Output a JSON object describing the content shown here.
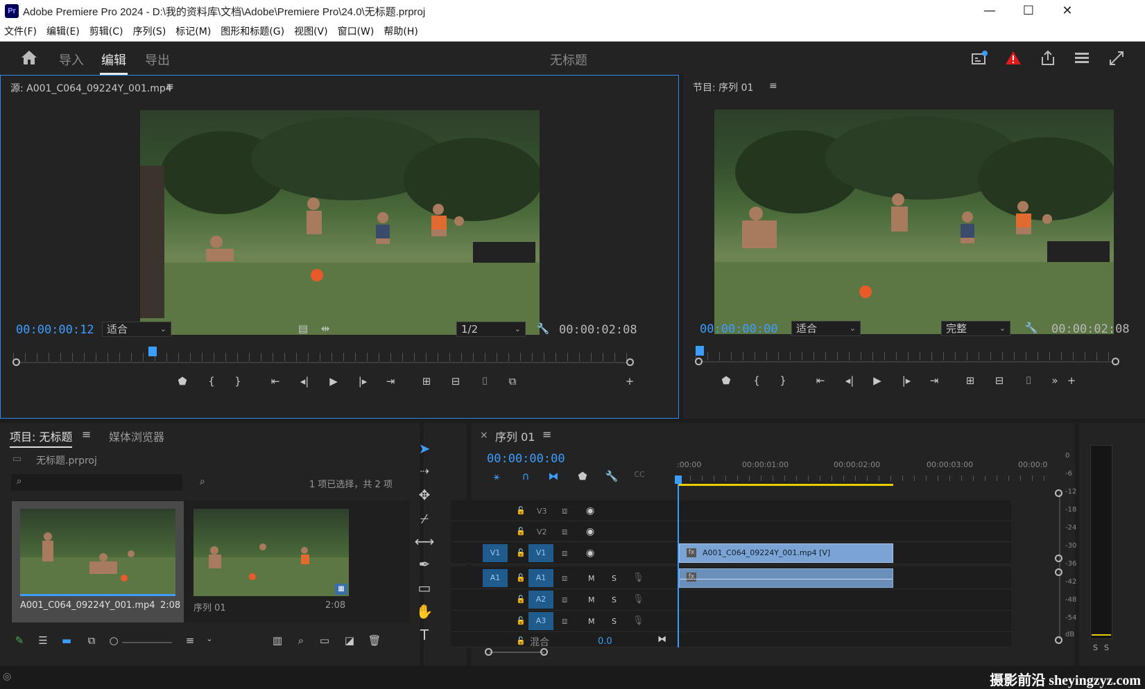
{
  "window": {
    "title": "Adobe Premiere Pro 2024 - D:\\我的资料库\\文档\\Adobe\\Premiere Pro\\24.0\\无标题.prproj",
    "app_badge": "Pr",
    "minimize": "—",
    "maximize": "☐",
    "close": "✕"
  },
  "menu": [
    "文件(F)",
    "编辑(E)",
    "剪辑(C)",
    "序列(S)",
    "标记(M)",
    "图形和标题(G)",
    "视图(V)",
    "窗口(W)",
    "帮助(H)"
  ],
  "workspace": {
    "tabs": [
      "导入",
      "编辑",
      "导出"
    ],
    "active": "编辑",
    "document": "无标题"
  },
  "source": {
    "title": "源: A001_C064_09224Y_001.mp4",
    "menu_icon": "≡",
    "timecode": "00:00:00:12",
    "fit": "适合",
    "resolution": "1/2",
    "duration": "00:00:02:08",
    "playhead_fraction": 0.22
  },
  "program": {
    "title": "节目: 序列 01",
    "menu_icon": "≡",
    "timecode": "00:00:00:00",
    "fit": "适合",
    "quality": "完整",
    "duration": "00:00:02:08",
    "playhead_fraction": 0.0
  },
  "project": {
    "tabs": [
      "项目: 无标题",
      "媒体浏览器"
    ],
    "file": "无标题.prproj",
    "selection_info": "1 项已选择，共 2 项",
    "items": [
      {
        "name": "A001_C064_09224Y_001.mp4",
        "duration": "2:08"
      },
      {
        "name": "序列 01",
        "duration": "2:08"
      }
    ]
  },
  "timeline": {
    "close": "×",
    "title": "序列 01",
    "menu_icon": "≡",
    "timecode": "00:00:00:00",
    "ruler": [
      ":00:00",
      "00:00:01:00",
      "00:00:02:00",
      "00:00:03:00",
      "00:00:0"
    ],
    "video_tracks": [
      "V3",
      "V2",
      "V1"
    ],
    "audio_tracks": [
      "A1",
      "A2",
      "A3"
    ],
    "mix_label": "混合",
    "mix_value": "0.0",
    "src_v": "V1",
    "src_a": "A1",
    "clip_label": "A001_C064_09224Y_001.mp4 [V]",
    "fx": "fx",
    "M": "M",
    "S": "S"
  },
  "meter": {
    "labels": [
      "0",
      "-6",
      "-12",
      "-18",
      "-24",
      "-30",
      "-36",
      "-42",
      "-48",
      "-54",
      "dB"
    ],
    "solo": [
      "S",
      "S"
    ]
  },
  "watermark": "摄影前沿 sheyingzyz.com",
  "colors": {
    "accent": "#3d9dff",
    "alert": "#e01b1b",
    "clip": "#7ba4d4",
    "track_target": "#1f5b8c",
    "work_area": "#e8d000"
  }
}
